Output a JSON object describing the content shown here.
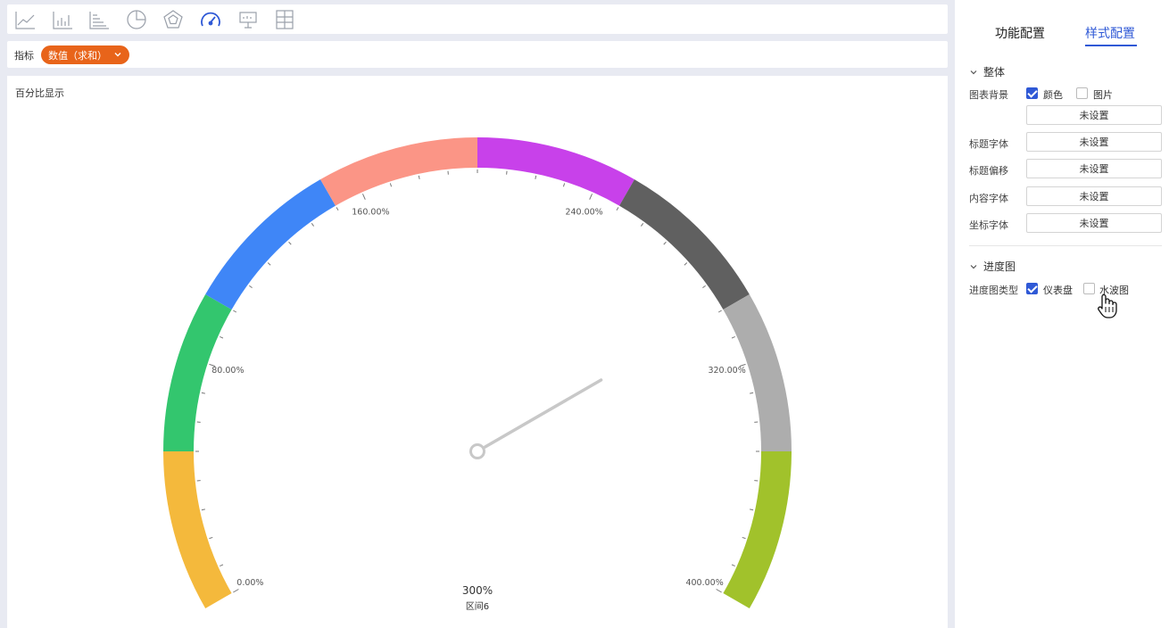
{
  "toolbar": {
    "icons": [
      {
        "name": "line-chart-icon"
      },
      {
        "name": "bar-chart-icon"
      },
      {
        "name": "horizontal-bar-icon"
      },
      {
        "name": "pie-chart-icon"
      },
      {
        "name": "radar-chart-icon"
      },
      {
        "name": "gauge-chart-icon",
        "active": true
      },
      {
        "name": "presentation-icon"
      },
      {
        "name": "grid-table-icon"
      }
    ]
  },
  "metric_bar": {
    "label": "指标",
    "pill": "数值（求和）",
    "pill_color": "#e8641a"
  },
  "chart_title": "百分比显示",
  "chart_data": {
    "type": "gauge",
    "min": 0,
    "max": 400,
    "value": 300,
    "value_label": "300%",
    "band_label": "区间6",
    "tick_labels": [
      "0.00%",
      "80.00%",
      "160.00%",
      "240.00%",
      "320.00%",
      "400.00%"
    ],
    "bands": [
      {
        "from": 0,
        "to": 50,
        "color": "#f4b93c"
      },
      {
        "from": 50,
        "to": 100,
        "color": "#33c66e"
      },
      {
        "from": 100,
        "to": 150,
        "color": "#3f86f7"
      },
      {
        "from": 150,
        "to": 200,
        "color": "#fb9586"
      },
      {
        "from": 200,
        "to": 250,
        "color": "#c841ea"
      },
      {
        "from": 250,
        "to": 300,
        "color": "#606060"
      },
      {
        "from": 300,
        "to": 350,
        "color": "#adadad"
      },
      {
        "from": 350,
        "to": 400,
        "color": "#a1c22b"
      }
    ]
  },
  "panel": {
    "tabs": [
      "功能配置",
      "样式配置"
    ],
    "active_tab": "样式配置",
    "accent": "#2f59d6",
    "section_overall": "整体",
    "bg_label": "图表背景",
    "bg_color_option": "颜色",
    "bg_image_option": "图片",
    "not_set": "未设置",
    "title_font_label": "标题字体",
    "title_offset_label": "标题偏移",
    "content_font_label": "内容字体",
    "axis_font_label": "坐标字体",
    "section_progress": "进度图",
    "progress_type_label": "进度图类型",
    "progress_gauge_option": "仪表盘",
    "progress_wave_option": "水波图"
  }
}
